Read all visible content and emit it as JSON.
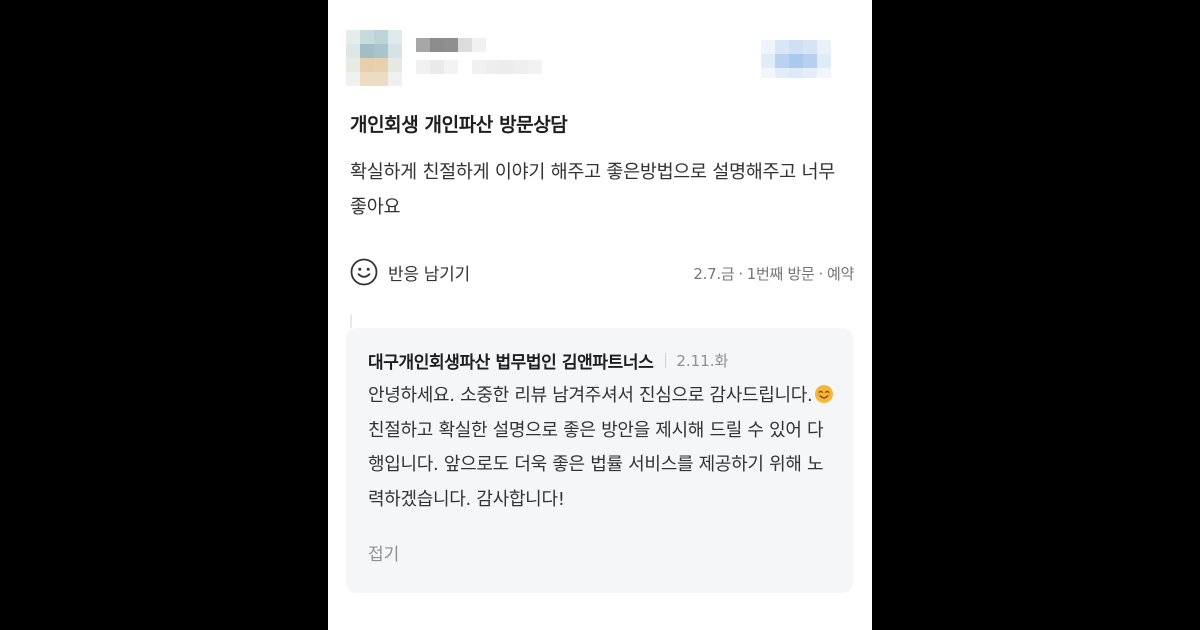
{
  "review": {
    "title": "개인회생 개인파산 방문상담",
    "body": "확실하게 친절하게 이야기 해주고 좋은방법으로 설명해주고 너무 좋아요",
    "react_label": "반응 남기기",
    "visit_date": "2.7.금",
    "visit_count": "1번째 방문",
    "visit_type": "예약",
    "separator": "·"
  },
  "reply": {
    "name": "대구개인회생파산 법무법인 김앤파트너스",
    "date": "2.11.화",
    "text_part1": "안녕하세요. 소중한 리뷰 남겨주셔서 진심으로 감사드립니다.",
    "text_part2": " 친절하고 확실한 설명으로 좋은 방안을 제시해 드릴 수 있어 다행입니다. 앞으로도 더욱 좋은 법률 서비스를 제공하기 위해 노력하겠습니다. 감사합니다!",
    "fold_label": "접기"
  },
  "icons": {
    "react": "smile-outline-icon",
    "reply_emoji": "smiling-face-emoji"
  },
  "colors": {
    "backdrop": "#000000",
    "card": "#ffffff",
    "reply_bg": "#f5f6f8",
    "meta_text": "#767676"
  }
}
